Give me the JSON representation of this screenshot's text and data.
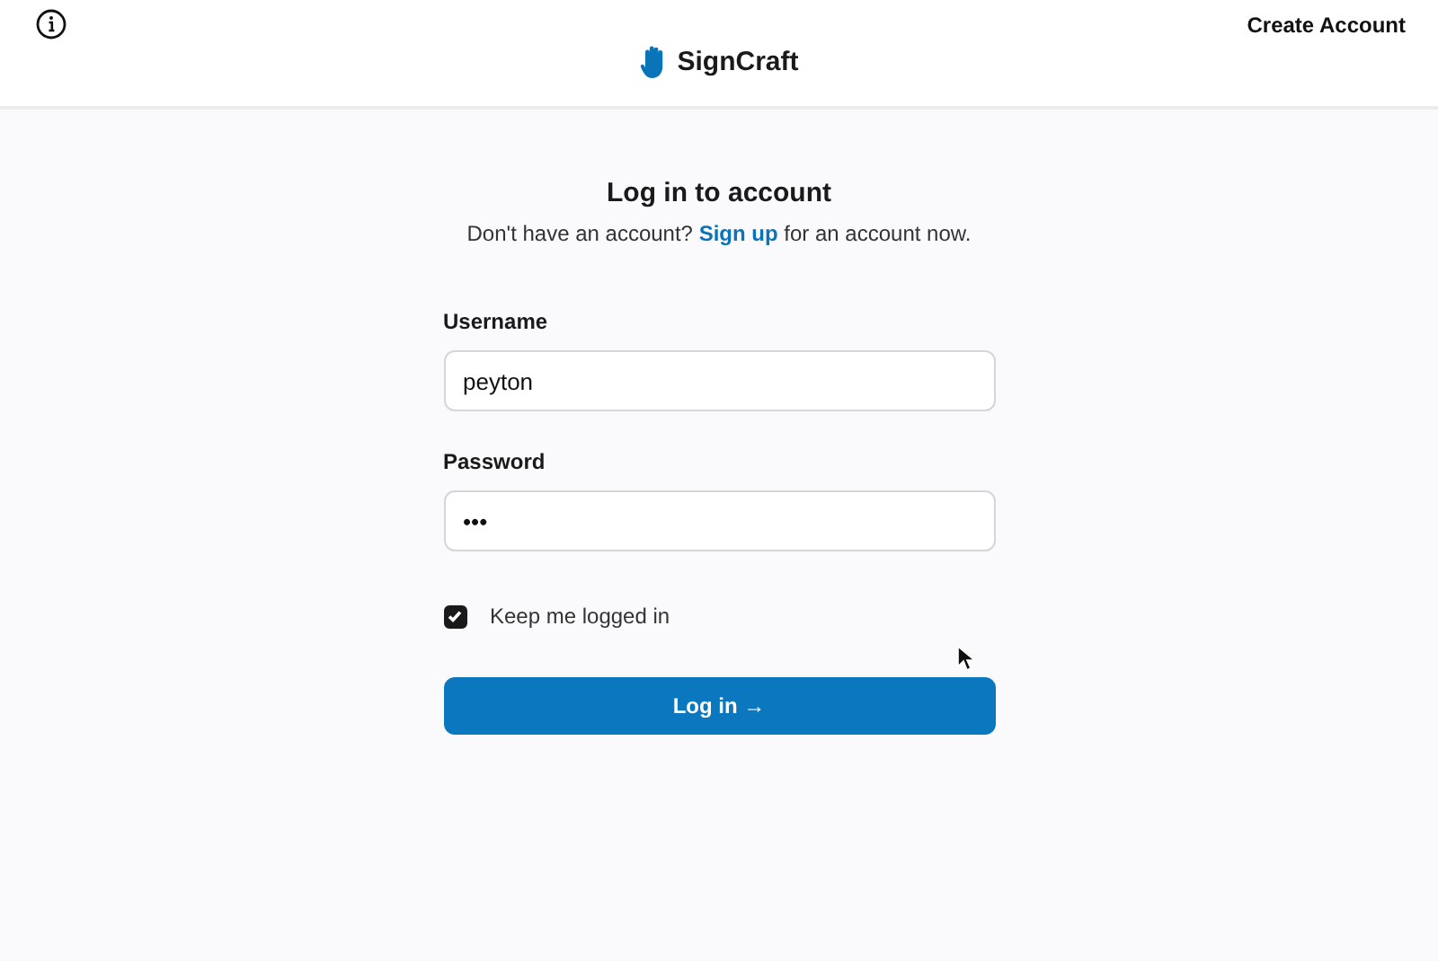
{
  "header": {
    "brand": "SignCraft",
    "create_account": "Create Account"
  },
  "login": {
    "title": "Log in to account",
    "signup_link": "Sign up",
    "subtitle_before": "Don't have an account?",
    "subtitle_after": "for an account now.",
    "fields": [
      {
        "label": "Username",
        "value": "peyton"
      },
      {
        "label": "Password",
        "value": "•••"
      }
    ],
    "remember": {
      "label": "Keep me logged in",
      "checked": true
    },
    "submit": "Log in →"
  }
}
